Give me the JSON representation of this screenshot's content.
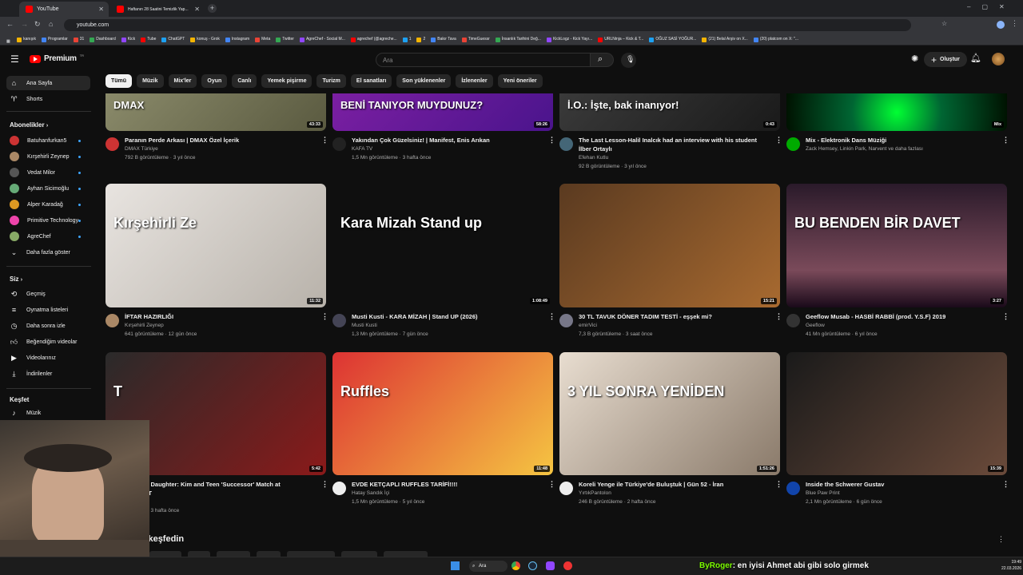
{
  "browser": {
    "tabs": [
      {
        "title": "YouTube"
      },
      {
        "title": "Haftanın 28 Saatini Temizlik Yap..."
      }
    ],
    "url": "youtube.com",
    "bookmarks": [
      "kanışık",
      "Programlar",
      "31",
      "Dashboard",
      "Kick",
      "Tube",
      "ChatGPT",
      "konuş - Grok",
      "Instagram",
      "Meta",
      "Twitter",
      "AgreChef - Social M...",
      "agrechef (@agreche...",
      "1",
      "2",
      "Bakır Tava",
      "TimeGuessr",
      "İnsanlık Tarihini Değ...",
      "KickLogz - Kick Yayı...",
      "URLNinja – Kick & T...",
      "OĞUZ SASİ YOĞUR...",
      "(21) Belal Arşiv on X...",
      "(20) platcom on X: \"..."
    ]
  },
  "header": {
    "brand": "Premium",
    "brand_sup": "TR",
    "search_placeholder": "Ara",
    "create_label": "Oluştur"
  },
  "chips": [
    "Tümü",
    "Müzik",
    "Mix'ler",
    "Oyun",
    "Canlı",
    "Yemek pişirme",
    "Turizm",
    "El sanatları",
    "Son yüklenenler",
    "İzlenenler",
    "Yeni öneriler"
  ],
  "sidebar": {
    "home": "Ana Sayfa",
    "shorts": "Shorts",
    "subs_head": "Abonelikler",
    "subs": [
      "Batuhanfurkan5",
      "Kırşehirli Zeynep",
      "Vedat Milor",
      "Ayhan Sicimoğlu",
      "Alper Karadağ",
      "Primitive Technology",
      "AgreChef"
    ],
    "more": "Daha fazla göster",
    "you_head": "Siz",
    "you": [
      "Geçmiş",
      "Oynatma listeleri",
      "Daha sonra izle",
      "Beğendiğim videolar",
      "Videolarınız",
      "İndirilenler"
    ],
    "explore_head": "Keşfet",
    "explore": [
      "Müzik"
    ]
  },
  "videos": [
    {
      "title": "Paranın Perde Arkası | DMAX Özel İçerik",
      "title2": "",
      "channel": "DMAX Türkiye",
      "meta": "792 B görüntüleme · 3 yıl önce",
      "duration": "43:33",
      "overlay": "DMAX"
    },
    {
      "title": "Yakından Çok Güzelsiniz! | Manifest, Enis Arıkan",
      "title2": "",
      "channel": "KAFA TV",
      "meta": "1,5 Mn görüntüleme · 3 hafta önce",
      "duration": "58:26",
      "overlay": "BENİ TANIYOR MUYDUNUZ?"
    },
    {
      "title": "The Last Lesson-Halil Inalcık had an interview with his student",
      "title2": "İlber Ortaylı",
      "channel": "Efehan Kutlu",
      "meta": "92 B görüntüleme · 3 yıl önce",
      "duration": "0:43",
      "overlay": "İ.O.: İşte, bak inanıyor!"
    },
    {
      "title": "Mix - Elektronik Dans Müziği",
      "title2": "",
      "channel": "Zack Hemsey, Linkin Park, Narvent ve daha fazlası",
      "meta": "",
      "duration": "Mix",
      "overlay": ""
    },
    {
      "title": "İFTAR HAZIRLIĞI",
      "title2": "",
      "channel": "Kırşehirli Zeynep",
      "meta": "641 görüntüleme · 12 gün önce",
      "duration": "11:32",
      "overlay": "Kırşehirli Ze"
    },
    {
      "title": "Musti Kusti - KARA MİZAH  | Stand UP (2026)",
      "title2": "",
      "channel": "Musti Kusti",
      "meta": "1,3 Mn görüntüleme · 7 gün önce",
      "duration": "1:08:49",
      "overlay": "Kara Mizah Stand up"
    },
    {
      "title": "30 TL TAVUK DÖNER TADIM TESTİ - eşşek mi?",
      "title2": "",
      "channel": "emirVici",
      "meta": "7,3 B görüntüleme · 3 saat önce",
      "duration": "15:21",
      "overlay": ""
    },
    {
      "title": "Geeflow Musab - HASBİ RABBİ (prod. Y.S.F) 2019",
      "title2": "",
      "channel": "Geeflow",
      "meta": "41 Mn görüntüleme · 6 yıl önce",
      "duration": "3:27",
      "overlay": "BU BENDEN BİR DAVET"
    },
    {
      "title": "her, Like Daughter: Kim and Teen 'Successor' Match at",
      "title2": "ade | APT",
      "channel": "",
      "meta": "üntüleme · 3 hafta önce",
      "duration": "5:42",
      "overlay": "T"
    },
    {
      "title": "EVDE KETÇAPLI RUFFLES TARİFİ!!!!",
      "title2": "",
      "channel": "Hatay Sandık İçi",
      "meta": "1,5 Mn görüntüleme · 5 yıl önce",
      "duration": "11:48",
      "overlay": "Ruffles"
    },
    {
      "title": "Koreli Yenge ile Türkiye'de Buluştuk | Gün 52 - İran",
      "title2": "",
      "channel": "YırtıkPantolon",
      "meta": "246 B görüntüleme · 2 hafta önce",
      "duration": "1:51:26",
      "overlay": "3 YIL SONRA YENİDEN"
    },
    {
      "title": "Inside the Schwerer Gustav",
      "title2": "",
      "channel": "Blue Paw Print",
      "meta": "2,1 Mn görüntüleme · 6 gün önce",
      "duration": "15:39",
      "overlay": ""
    }
  ],
  "section_title": "ar keşfedin",
  "taskbar": {
    "search": "Ara",
    "time": "19:49",
    "date": "22.03.2026",
    "chat_user": "ByRoger",
    "chat_text": ": en iyisi Ahmet abi gibi solo girmek"
  }
}
